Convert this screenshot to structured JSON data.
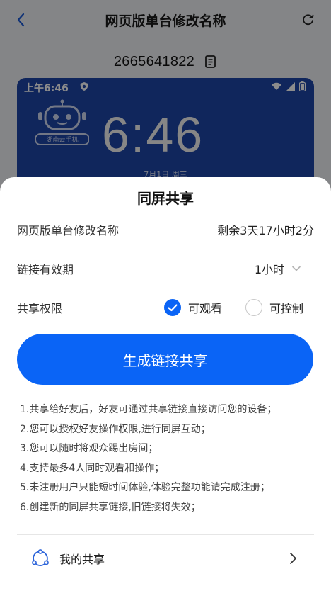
{
  "header": {
    "title": "网页版单台修改名称",
    "device_id": "2665641822"
  },
  "phone_preview": {
    "status_time": "上午6:46",
    "clock": "6:46",
    "date": "7月1日 周三",
    "robot_label": "湖南云手机"
  },
  "sheet": {
    "title": "同屏共享",
    "device_name": "网页版单台修改名称",
    "remaining": "剩余3天17小时2分",
    "validity_label": "链接有效期",
    "validity_value": "1小时",
    "permission_label": "共享权限",
    "permission_options": [
      {
        "label": "可观看",
        "selected": true
      },
      {
        "label": "可控制",
        "selected": false
      }
    ],
    "generate_button": "生成链接共享",
    "notes": [
      "1.共享给好友后，好友可通过共享链接直接访问您的设备；",
      "2.您可以授权好友操作权限,进行同屏互动；",
      "3.您可以随时将观众踢出房间；",
      "4.支持最多4人同时观看和操作；",
      "5.未注册用户只能短时间体验,体验完整功能请完成注册；",
      "6.创建新的同屏共享链接,旧链接将失效；"
    ],
    "my_share_label": "我的共享"
  },
  "colors": {
    "accent": "#0a64f6",
    "phone_bg": "#1e46a8",
    "overlay": "rgba(0,0,0,0.45)"
  },
  "icons": {
    "back": "chevron-left-icon",
    "refresh": "refresh-icon",
    "copy": "copy-icon",
    "dropdown": "chevron-down-icon",
    "check": "check-icon",
    "share": "share-icon",
    "forward": "chevron-right-icon"
  }
}
